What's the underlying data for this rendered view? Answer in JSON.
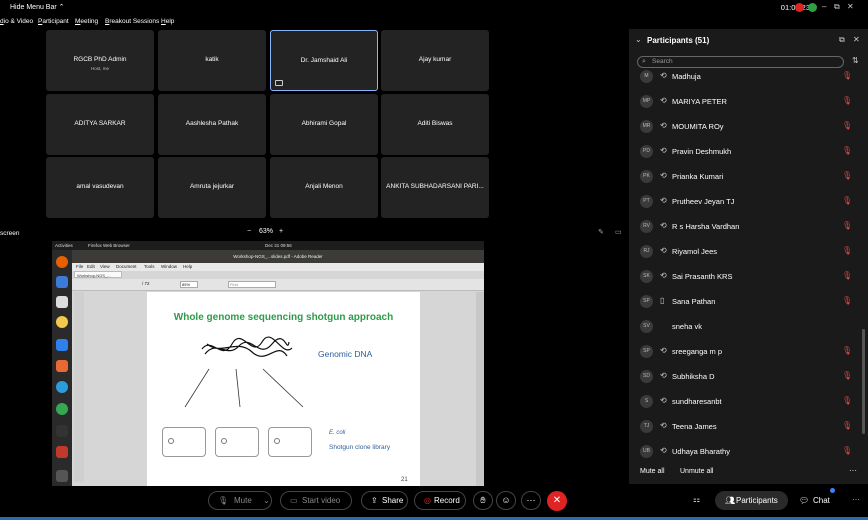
{
  "topbar": {
    "hide_menu": "Hide Menu Bar",
    "timer": "01:03:23",
    "colors": {
      "red": "#e02424",
      "green": "#2ea043"
    }
  },
  "menubar": [
    "dio & Video",
    "Participant",
    "Meeting",
    "Breakout Sessions",
    "Help"
  ],
  "tiles": [
    {
      "name": "RGCB PhD Admin",
      "sub": "Host, me"
    },
    {
      "name": "katik"
    },
    {
      "name": "Dr. Jamshaid Ali",
      "active": true
    },
    {
      "name": "Ajay kumar"
    },
    {
      "name": "ADITYA SARKAR"
    },
    {
      "name": "Aashlesha Pathak"
    },
    {
      "name": "Abhirami Gopal"
    },
    {
      "name": "Aditi Biswas"
    },
    {
      "name": "amal vasudevan"
    },
    {
      "name": "Amruta jejurkar"
    },
    {
      "name": "Anjali Menon"
    },
    {
      "name": "ANKITA SUBHADARSANI PARI..."
    }
  ],
  "zoom": {
    "minus": "−",
    "value": "63%",
    "plus": "+"
  },
  "screen_label": "screen",
  "shared": {
    "ubuntu_bar": {
      "activities": "Activities",
      "browser": "Firefox Web Browser",
      "clock": "Dec 31  09:56"
    },
    "reader_title": "Workshop-NGS_...slides.pdf - Adobe Reader",
    "reader_menu": [
      "File",
      "Edit",
      "View",
      "Document",
      "Tools",
      "Window",
      "Help"
    ],
    "tab_label": "Workshop-NGS_...",
    "page_box": "/ 72",
    "zoom_box": "85%",
    "find_box": "Find",
    "slide": {
      "title": "Whole genome sequencing shotgun approach",
      "dna_label": "Genomic DNA",
      "ecoli": "E. coli",
      "library": "Shotgun clone library",
      "page_number": "21"
    }
  },
  "panel": {
    "title": "Participants (51)",
    "search_placeholder": "Search",
    "participants": [
      {
        "initials": "M",
        "name": "Madhuja"
      },
      {
        "initials": "MP",
        "name": "MARIYA PETER"
      },
      {
        "initials": "MR",
        "name": "MOUMITA ROy"
      },
      {
        "initials": "PD",
        "name": "Pravin Deshmukh"
      },
      {
        "initials": "PK",
        "name": "Prianka Kumari"
      },
      {
        "initials": "PT",
        "name": "Prutheev Jeyan TJ"
      },
      {
        "initials": "RV",
        "name": "R s Harsha Vardhan"
      },
      {
        "initials": "RJ",
        "name": "Riyamol Jees"
      },
      {
        "initials": "SK",
        "name": "Sai Prasanth KRS"
      },
      {
        "initials": "SP",
        "name": "Sana Pathan",
        "phone": true
      },
      {
        "initials": "SV",
        "name": "sneha vk",
        "no_icons": true
      },
      {
        "initials": "SP",
        "name": "sreeganga m p"
      },
      {
        "initials": "SD",
        "name": "Subhiksha D"
      },
      {
        "initials": "S",
        "name": "sundharesanbt"
      },
      {
        "initials": "TJ",
        "name": "Teena James"
      },
      {
        "initials": "UB",
        "name": "Udhaya Bharathy"
      }
    ],
    "mute_all": "Mute all",
    "unmute_all": "Unmute all"
  },
  "toolbar": {
    "mute": "Mute",
    "start_video": "Start video",
    "share": "Share",
    "record": "Record",
    "participants": "Participants",
    "chat": "Chat"
  }
}
